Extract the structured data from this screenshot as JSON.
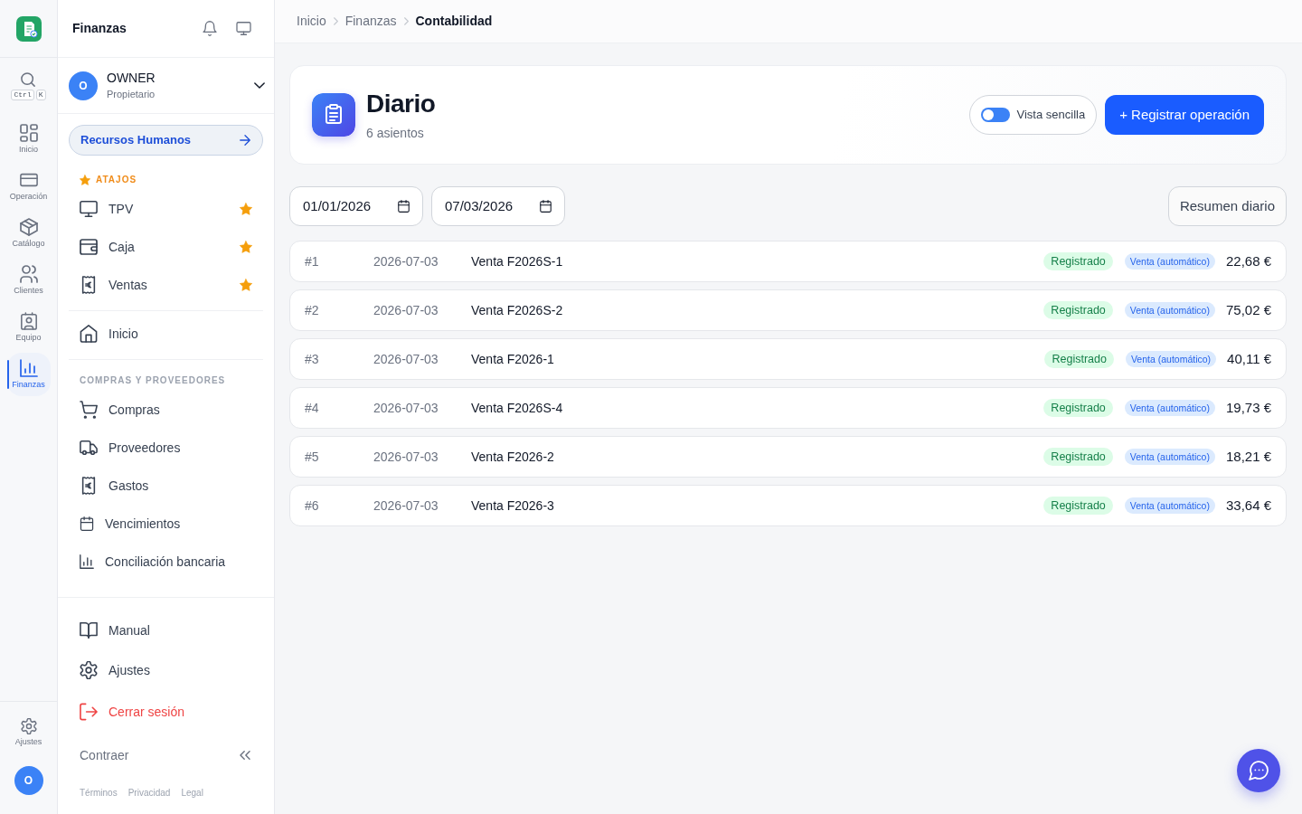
{
  "rail": {
    "search_shortcut": [
      "Ctrl",
      "K"
    ],
    "items": [
      {
        "label": "Inicio",
        "selected": false
      },
      {
        "label": "Operación",
        "selected": false
      },
      {
        "label": "Catálogo",
        "selected": false
      },
      {
        "label": "Clientes",
        "selected": false
      },
      {
        "label": "Equipo",
        "selected": false
      },
      {
        "label": "Finanzas",
        "selected": true
      }
    ],
    "bottom_items": [
      {
        "label": "Ajustes"
      }
    ],
    "user_initial": "O"
  },
  "sidebar": {
    "title": "Finanzas",
    "user": {
      "initial": "O",
      "name": "OWNER",
      "role": "Propietario"
    },
    "module_link": "Recursos Humanos",
    "shortcuts": {
      "heading": "ATAJOS",
      "items": [
        {
          "label": "TPV",
          "starred": true
        },
        {
          "label": "Caja",
          "starred": true
        },
        {
          "label": "Ventas",
          "starred": true
        }
      ]
    },
    "links": [
      {
        "label": "Inicio"
      }
    ],
    "sections": [
      {
        "heading": "COMPRAS Y PROVEEDORES",
        "items": [
          {
            "label": "Compras"
          },
          {
            "label": "Proveedores"
          },
          {
            "label": "Gastos"
          },
          {
            "label": "Vencimientos"
          },
          {
            "label": "Conciliación bancaria"
          }
        ]
      }
    ],
    "footer_items": [
      {
        "label": "Manual",
        "kind": "link"
      },
      {
        "label": "Ajustes",
        "kind": "link"
      },
      {
        "label": "Cerrar sesión",
        "kind": "danger"
      }
    ],
    "collapse_label": "Contraer",
    "legal_links": [
      "Términos",
      "Privacidad",
      "Legal"
    ]
  },
  "breadcrumb": [
    {
      "label": "Inicio",
      "current": false
    },
    {
      "label": "Finanzas",
      "current": false
    },
    {
      "label": "Contabilidad",
      "current": true
    }
  ],
  "page": {
    "title": "Diario",
    "subtitle": "6 asientos",
    "simple_view": {
      "label": "Vista sencilla",
      "on": false
    },
    "primary_action": "+ Registrar operación"
  },
  "filters": {
    "date_from": "01/01/2026",
    "date_to": "07/03/2026",
    "summary_button": "Resumen diario"
  },
  "entries": [
    {
      "number": "#1",
      "date": "2026-07-03",
      "description": "Venta F2026S-1",
      "status": "Registrado",
      "source": "Venta (automático)",
      "amount": "22,68 €"
    },
    {
      "number": "#2",
      "date": "2026-07-03",
      "description": "Venta F2026S-2",
      "status": "Registrado",
      "source": "Venta (automático)",
      "amount": "75,02 €"
    },
    {
      "number": "#3",
      "date": "2026-07-03",
      "description": "Venta F2026-1",
      "status": "Registrado",
      "source": "Venta (automático)",
      "amount": "40,11 €"
    },
    {
      "number": "#4",
      "date": "2026-07-03",
      "description": "Venta F2026S-4",
      "status": "Registrado",
      "source": "Venta (automático)",
      "amount": "19,73 €"
    },
    {
      "number": "#5",
      "date": "2026-07-03",
      "description": "Venta F2026-2",
      "status": "Registrado",
      "source": "Venta (automático)",
      "amount": "18,21 €"
    },
    {
      "number": "#6",
      "date": "2026-07-03",
      "description": "Venta F2026-3",
      "status": "Registrado",
      "source": "Venta (automático)",
      "amount": "33,64 €"
    }
  ]
}
